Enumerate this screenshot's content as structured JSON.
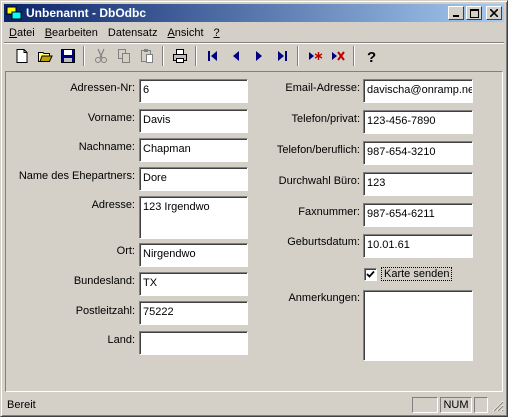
{
  "window": {
    "title": "Unbenannt - DbOdbc"
  },
  "menu": [
    {
      "underline": "D",
      "rest": "atei"
    },
    {
      "underline": "B",
      "rest": "earbeiten"
    },
    {
      "underline": "",
      "rest": "Datensatz"
    },
    {
      "underline": "A",
      "rest": "nsicht"
    },
    {
      "underline": "?",
      "rest": ""
    }
  ],
  "toolbar": {
    "buttons": [
      "new-icon",
      "open-icon",
      "save-icon",
      "cut-icon",
      "copy-icon",
      "paste-icon",
      "print-icon",
      "first-record-icon",
      "prev-record-icon",
      "next-record-icon",
      "last-record-icon",
      "new-record-icon",
      "delete-record-icon",
      "help-icon"
    ],
    "colors": {
      "nav": "#000080",
      "delete": "#c00000"
    }
  },
  "form": {
    "left": [
      {
        "label": "Adressen-Nr:",
        "value": "6"
      },
      {
        "label": "Vorname:",
        "value": "Davis"
      },
      {
        "label": "Nachname:",
        "value": "Chapman"
      },
      {
        "label": "Name des Ehepartners:",
        "value": "Dore"
      },
      {
        "label": "Adresse:",
        "value": "123 Irgendwo"
      },
      {
        "label": "Ort:",
        "value": "Nirgendwo"
      },
      {
        "label": "Bundesland:",
        "value": "TX"
      },
      {
        "label": "Postleitzahl:",
        "value": "75222"
      },
      {
        "label": "Land:",
        "value": ""
      }
    ],
    "right": [
      {
        "label": "Email-Adresse:",
        "value": "davischa@onramp.ne"
      },
      {
        "label": "Telefon/privat:",
        "value": "123-456-7890"
      },
      {
        "label": "Telefon/beruflich:",
        "value": "987-654-3210"
      },
      {
        "label": "Durchwahl Büro:",
        "value": "123"
      },
      {
        "label": "Faxnummer:",
        "value": "987-654-6211"
      },
      {
        "label": "Geburtsdatum:",
        "value": "10.01.61"
      }
    ],
    "checkbox": {
      "label": "Karte senden",
      "checked": true
    },
    "notes": {
      "label": "Anmerkungen:",
      "value": ""
    }
  },
  "status": {
    "text": "Bereit",
    "num": "NUM"
  }
}
